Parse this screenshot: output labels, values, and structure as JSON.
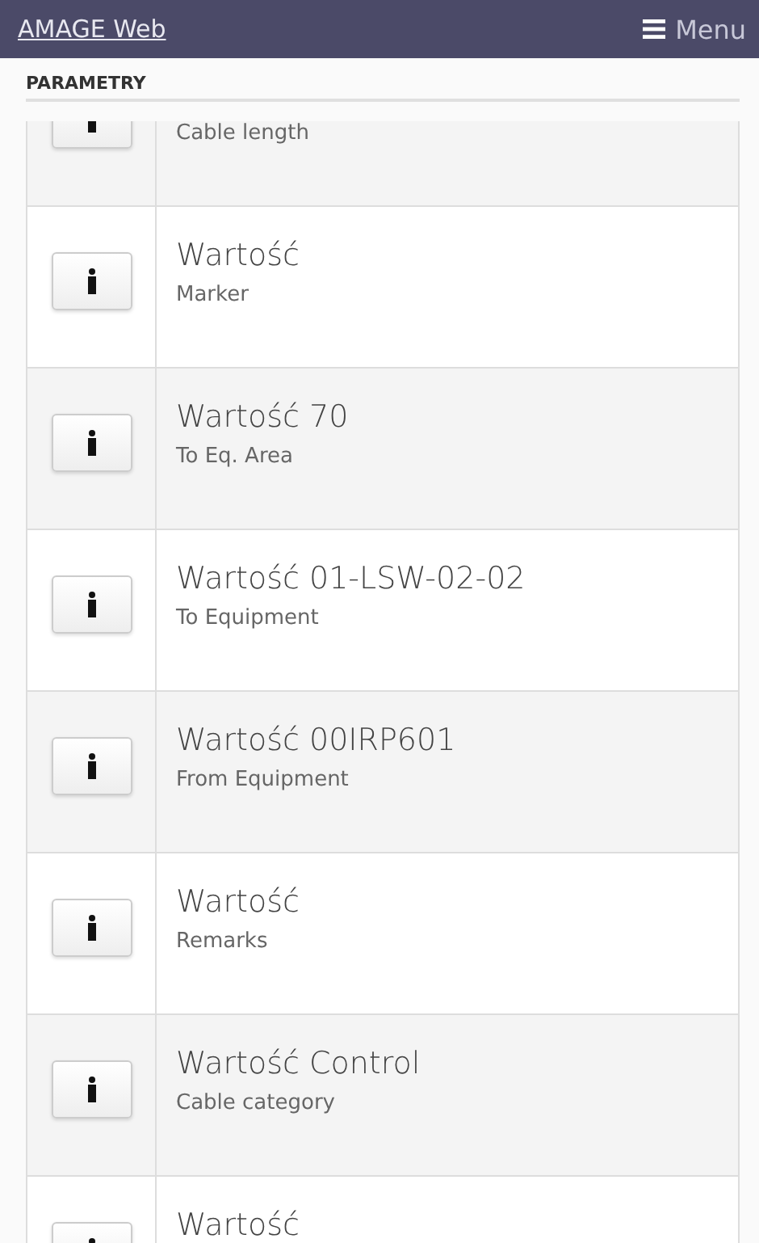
{
  "header": {
    "brand": "AMAGE Web",
    "menu_label": "Menu"
  },
  "section": {
    "title": "PARAMETRY"
  },
  "rows": [
    {
      "title": "",
      "subtitle": "Cable length"
    },
    {
      "title": "Wartość",
      "subtitle": "Marker"
    },
    {
      "title": "Wartość 70",
      "subtitle": "To Eq. Area"
    },
    {
      "title": "Wartość 01-LSW-02-02",
      "subtitle": "To Equipment"
    },
    {
      "title": "Wartość 00IRP601",
      "subtitle": "From Equipment"
    },
    {
      "title": "Wartość",
      "subtitle": "Remarks"
    },
    {
      "title": "Wartość Control",
      "subtitle": "Cable category"
    },
    {
      "title": "Wartość",
      "subtitle": ""
    }
  ]
}
